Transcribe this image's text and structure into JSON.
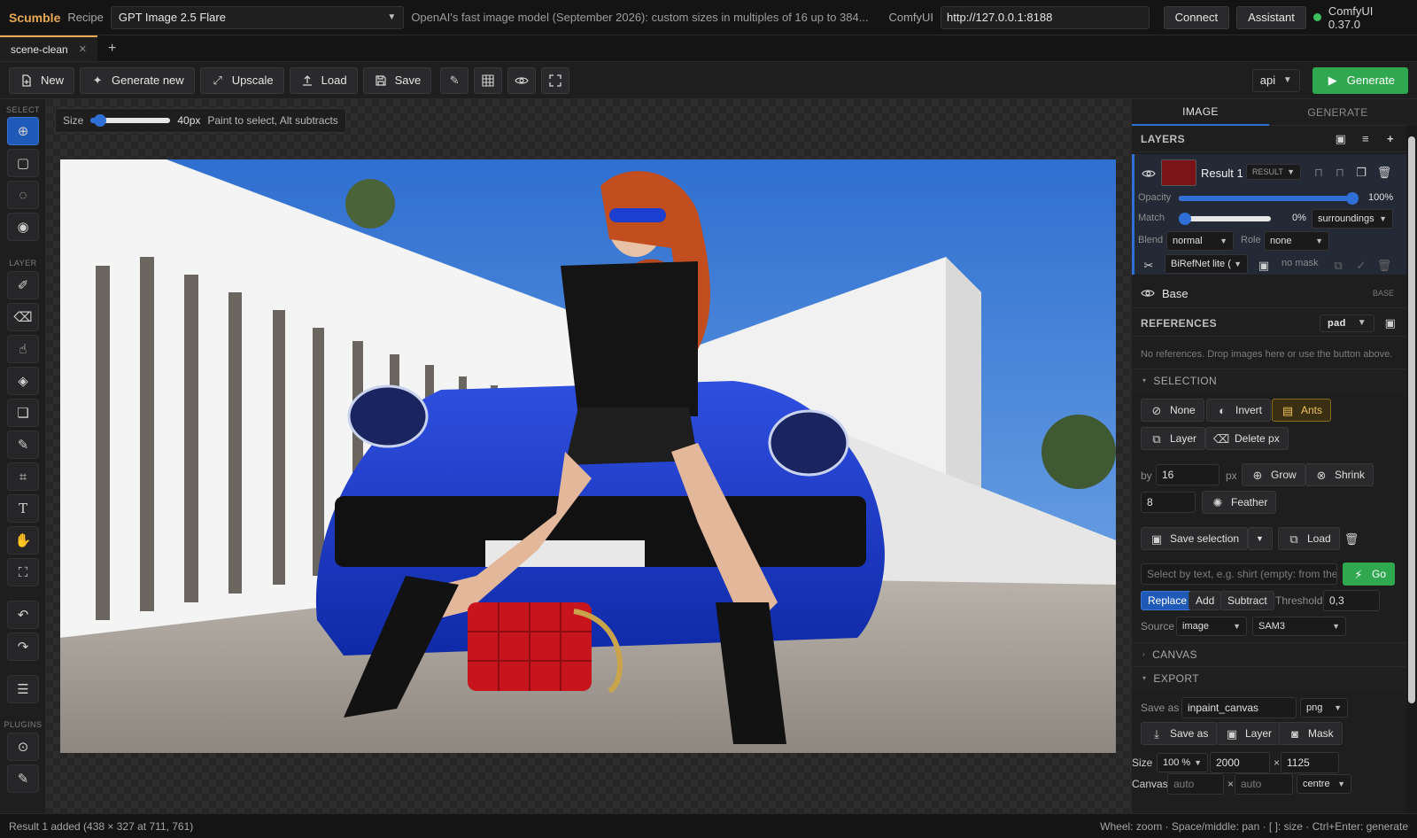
{
  "topbar": {
    "app_name": "Scumble",
    "recipe_label": "Recipe",
    "recipe_value": "GPT Image 2.5 Flare",
    "recipe_description": "OpenAI's fast image model (September 2026): custom sizes in multiples of 16 up to 384...",
    "server_label": "ComfyUI",
    "server_url": "http://127.0.0.1:8188",
    "connect_label": "Connect",
    "assistant_label": "Assistant",
    "status_text": "ComfyUI 0.37.0",
    "status_color": "#3fbf5f"
  },
  "tabs": [
    {
      "label": "scene-clean",
      "active": true
    }
  ],
  "toolbar": {
    "new_label": "New",
    "generate_new_label": "Generate new",
    "upscale_label": "Upscale",
    "load_label": "Load",
    "save_label": "Save",
    "mode_select": "api",
    "generate_label": "Generate"
  },
  "leftbar": {
    "select_section": "SELECT",
    "layer_section": "LAYER",
    "plugins_section": "PLUGINS"
  },
  "brush": {
    "size_label": "Size",
    "size_value": "40px",
    "size_fraction": 0.12,
    "hint": "Paint to select, Alt subtracts"
  },
  "panel": {
    "tabs": [
      "IMAGE",
      "GENERATE"
    ],
    "layers_title": "LAYERS",
    "layer": {
      "name": "Result 1",
      "role_badge": "RESULT",
      "opacity_label": "Opacity",
      "opacity_value": "100%",
      "opacity_fraction": 1.0,
      "match_label": "Match",
      "match_value": "0%",
      "match_fraction": 0.0,
      "match_mode": "surroundings",
      "blend_label": "Blend",
      "blend_value": "normal",
      "role_label": "Role",
      "role_value": "none",
      "segmenter": "BiRefNet lite (",
      "mask_status": "no mask"
    },
    "base_layer": {
      "name": "Base",
      "badge": "BASE"
    },
    "references": {
      "title": "REFERENCES",
      "mode": "pad",
      "empty_text": "No references. Drop images here or use the button above."
    },
    "selection": {
      "title": "SELECTION",
      "none_label": "None",
      "invert_label": "Invert",
      "ants_label": "Ants",
      "layer_label": "Layer",
      "delete_px_label": "Delete px",
      "by_label": "by",
      "by_value": "16",
      "px_label": "px",
      "grow_label": "Grow",
      "shrink_label": "Shrink",
      "feather_value": "8",
      "feather_label": "Feather",
      "save_selection_label": "Save selection",
      "load_label": "Load",
      "text_placeholder": "Select by text, e.g. shirt (empty: from the",
      "go_label": "Go",
      "modes": [
        "Replace",
        "Add",
        "Subtract"
      ],
      "active_mode": "Replace",
      "threshold_label": "Threshold",
      "threshold_value": "0,3",
      "source_label": "Source",
      "source_value": "image",
      "model_value": "SAM3"
    },
    "canvas_title": "CANVAS",
    "export": {
      "title": "EXPORT",
      "save_as_label": "Save as",
      "filename": "inpaint_canvas",
      "format": "png",
      "save_as_button": "Save as",
      "layer_button": "Layer",
      "mask_button": "Mask",
      "size_label": "Size",
      "scale": "100 %",
      "width": "2000",
      "times": "×",
      "height": "1125",
      "canvas_label": "Canvas",
      "canvas_w_placeholder": "auto",
      "canvas_h_placeholder": "auto",
      "anchor": "centre"
    }
  },
  "statusbar": {
    "left": "Result 1 added (438 × 327 at 711, 761)",
    "right": "Wheel: zoom · Space/middle: pan · [ ]: size · Ctrl+Enter: generate"
  },
  "icons": [
    "file-icon",
    "sparkle-icon",
    "expand-icon",
    "upload-icon",
    "save-icon",
    "pencil-icon",
    "grid-icon",
    "eye-icon",
    "fullscreen-icon",
    "play-icon"
  ]
}
